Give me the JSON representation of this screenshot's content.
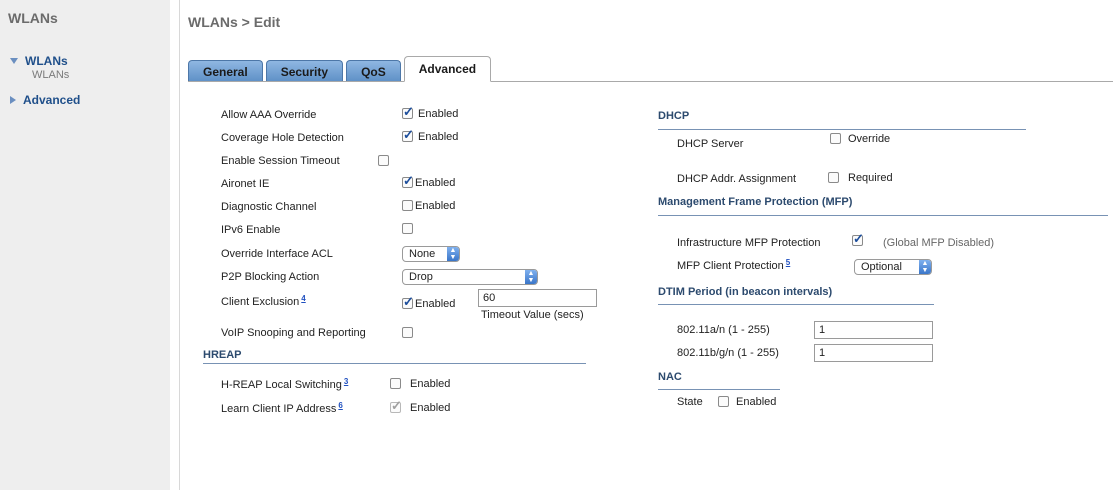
{
  "sidebar": {
    "title": "WLANs",
    "items": [
      {
        "label": "WLANs",
        "sub": "WLANs"
      },
      {
        "label": "Advanced"
      }
    ]
  },
  "page": {
    "title": "WLANs > Edit"
  },
  "tabs": [
    "General",
    "Security",
    "QoS",
    "Advanced"
  ],
  "left": {
    "allow_aaa": {
      "label": "Allow AAA Override",
      "value": "Enabled"
    },
    "coverage": {
      "label": "Coverage Hole Detection",
      "value": "Enabled"
    },
    "session_timeout": {
      "label": "Enable Session Timeout"
    },
    "aironet": {
      "label": "Aironet IE",
      "value": "Enabled"
    },
    "diag": {
      "label": "Diagnostic Channel",
      "value": "Enabled"
    },
    "ipv6": {
      "label": "IPv6 Enable"
    },
    "override_acl": {
      "label": "Override Interface ACL",
      "value": "None"
    },
    "p2p": {
      "label": "P2P Blocking Action",
      "value": "Drop"
    },
    "client_excl": {
      "label": "Client Exclusion",
      "footnote": "4",
      "value": "Enabled",
      "timeout": "60",
      "timeout_label": "Timeout Value (secs)"
    },
    "voip": {
      "label": "VoIP Snooping and Reporting"
    },
    "hreap_title": "HREAP",
    "hreap_local": {
      "label": "H-REAP Local Switching",
      "footnote": "3",
      "value": "Enabled"
    },
    "learn_ip": {
      "label": "Learn Client IP Address",
      "footnote": "6",
      "value": "Enabled"
    }
  },
  "right": {
    "dhcp_title": "DHCP",
    "dhcp_server": {
      "label": "DHCP Server",
      "value": "Override"
    },
    "dhcp_addr": {
      "label": "DHCP Addr. Assignment",
      "value": "Required"
    },
    "mfp_title": "Management Frame Protection (MFP)",
    "infra_mfp": {
      "label": "Infrastructure MFP Protection",
      "note": "(Global MFP Disabled)"
    },
    "mfp_client": {
      "label": "MFP Client Protection",
      "footnote": "5",
      "value": "Optional"
    },
    "dtim_title": "DTIM Period (in beacon intervals)",
    "dtim_a": {
      "label": "802.11a/n (1 - 255)",
      "value": "1"
    },
    "dtim_bg": {
      "label": "802.11b/g/n (1 - 255)",
      "value": "1"
    },
    "nac_title": "NAC",
    "nac_state": {
      "label": "State",
      "value": "Enabled"
    }
  },
  "colors": {
    "accent": "#1f4f8a",
    "section": "#2c4a6e",
    "tab": "#6b9ad0"
  }
}
